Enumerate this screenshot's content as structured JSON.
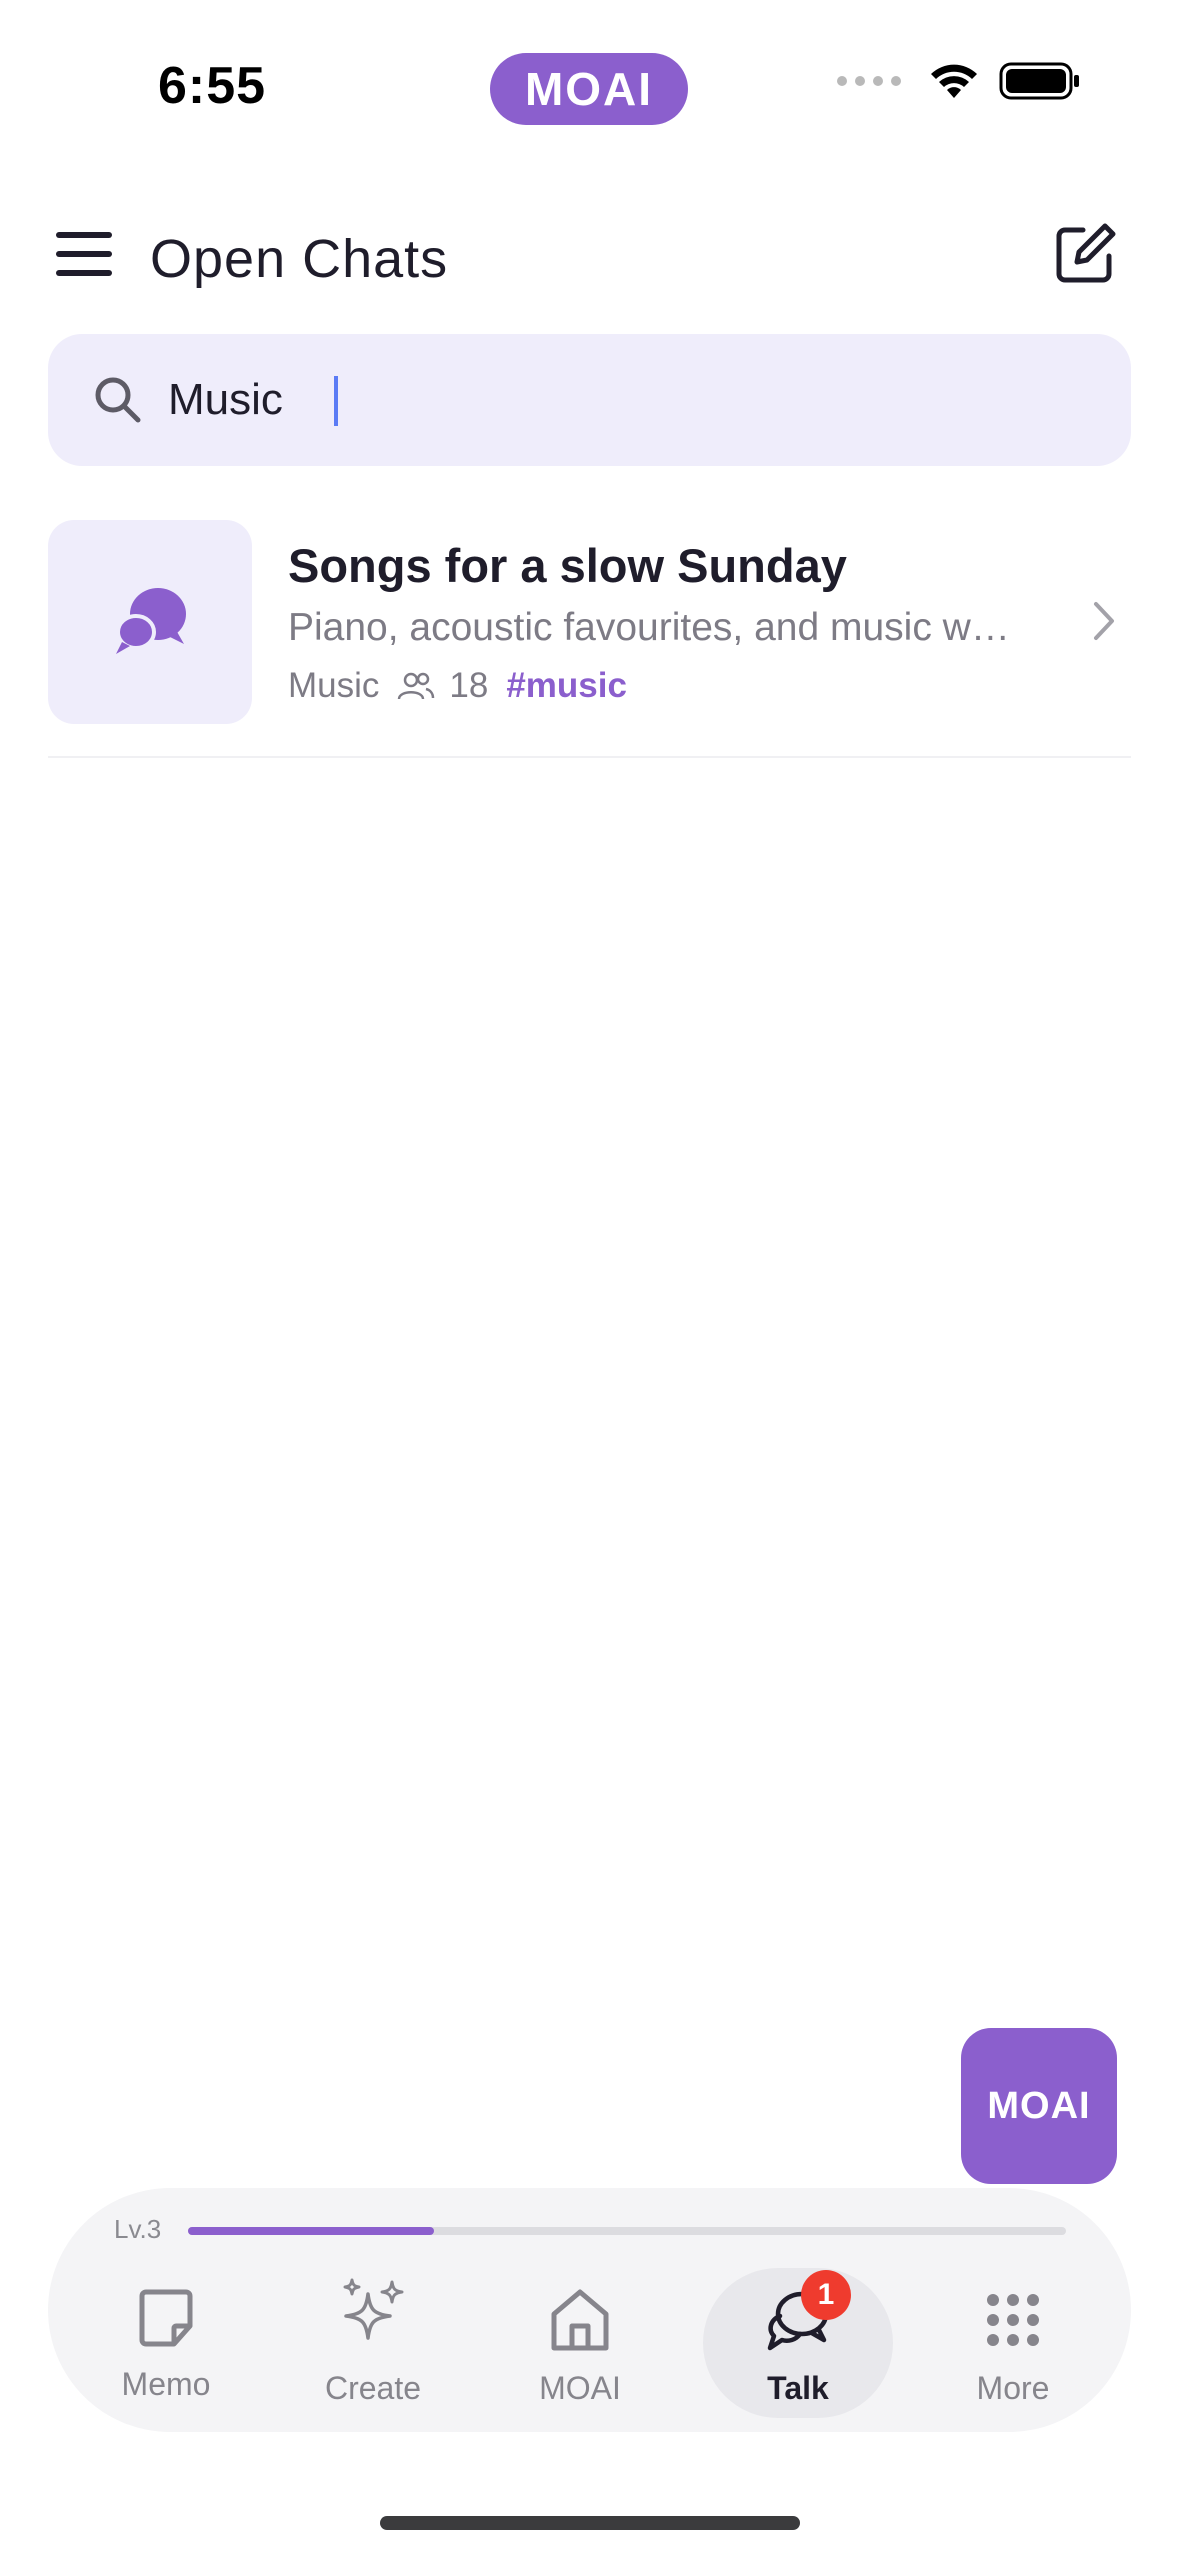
{
  "status_bar": {
    "time": "6:55",
    "app_pill": "MOAI"
  },
  "header": {
    "title": "Open Chats"
  },
  "search": {
    "value": "Music",
    "placeholder": ""
  },
  "results": [
    {
      "title": "Songs for a slow Sunday",
      "description": "Piano, acoustic favourites, and music w…",
      "category": "Music",
      "members": "18",
      "tag": "#music"
    }
  ],
  "fab": {
    "label": "MOAI"
  },
  "level": {
    "label": "Lv.3",
    "progress": 0.28
  },
  "nav": {
    "items": [
      {
        "label": "Memo",
        "icon": "memo-icon"
      },
      {
        "label": "Create",
        "icon": "sparkle-icon"
      },
      {
        "label": "MOAI",
        "icon": "home-icon"
      },
      {
        "label": "Talk",
        "icon": "chat-icon",
        "badge": "1",
        "active": true
      },
      {
        "label": "More",
        "icon": "grid-icon"
      }
    ]
  },
  "colors": {
    "accent": "#8b5fcd",
    "search_bg": "#efedfb",
    "badge": "#ef3b2e"
  }
}
